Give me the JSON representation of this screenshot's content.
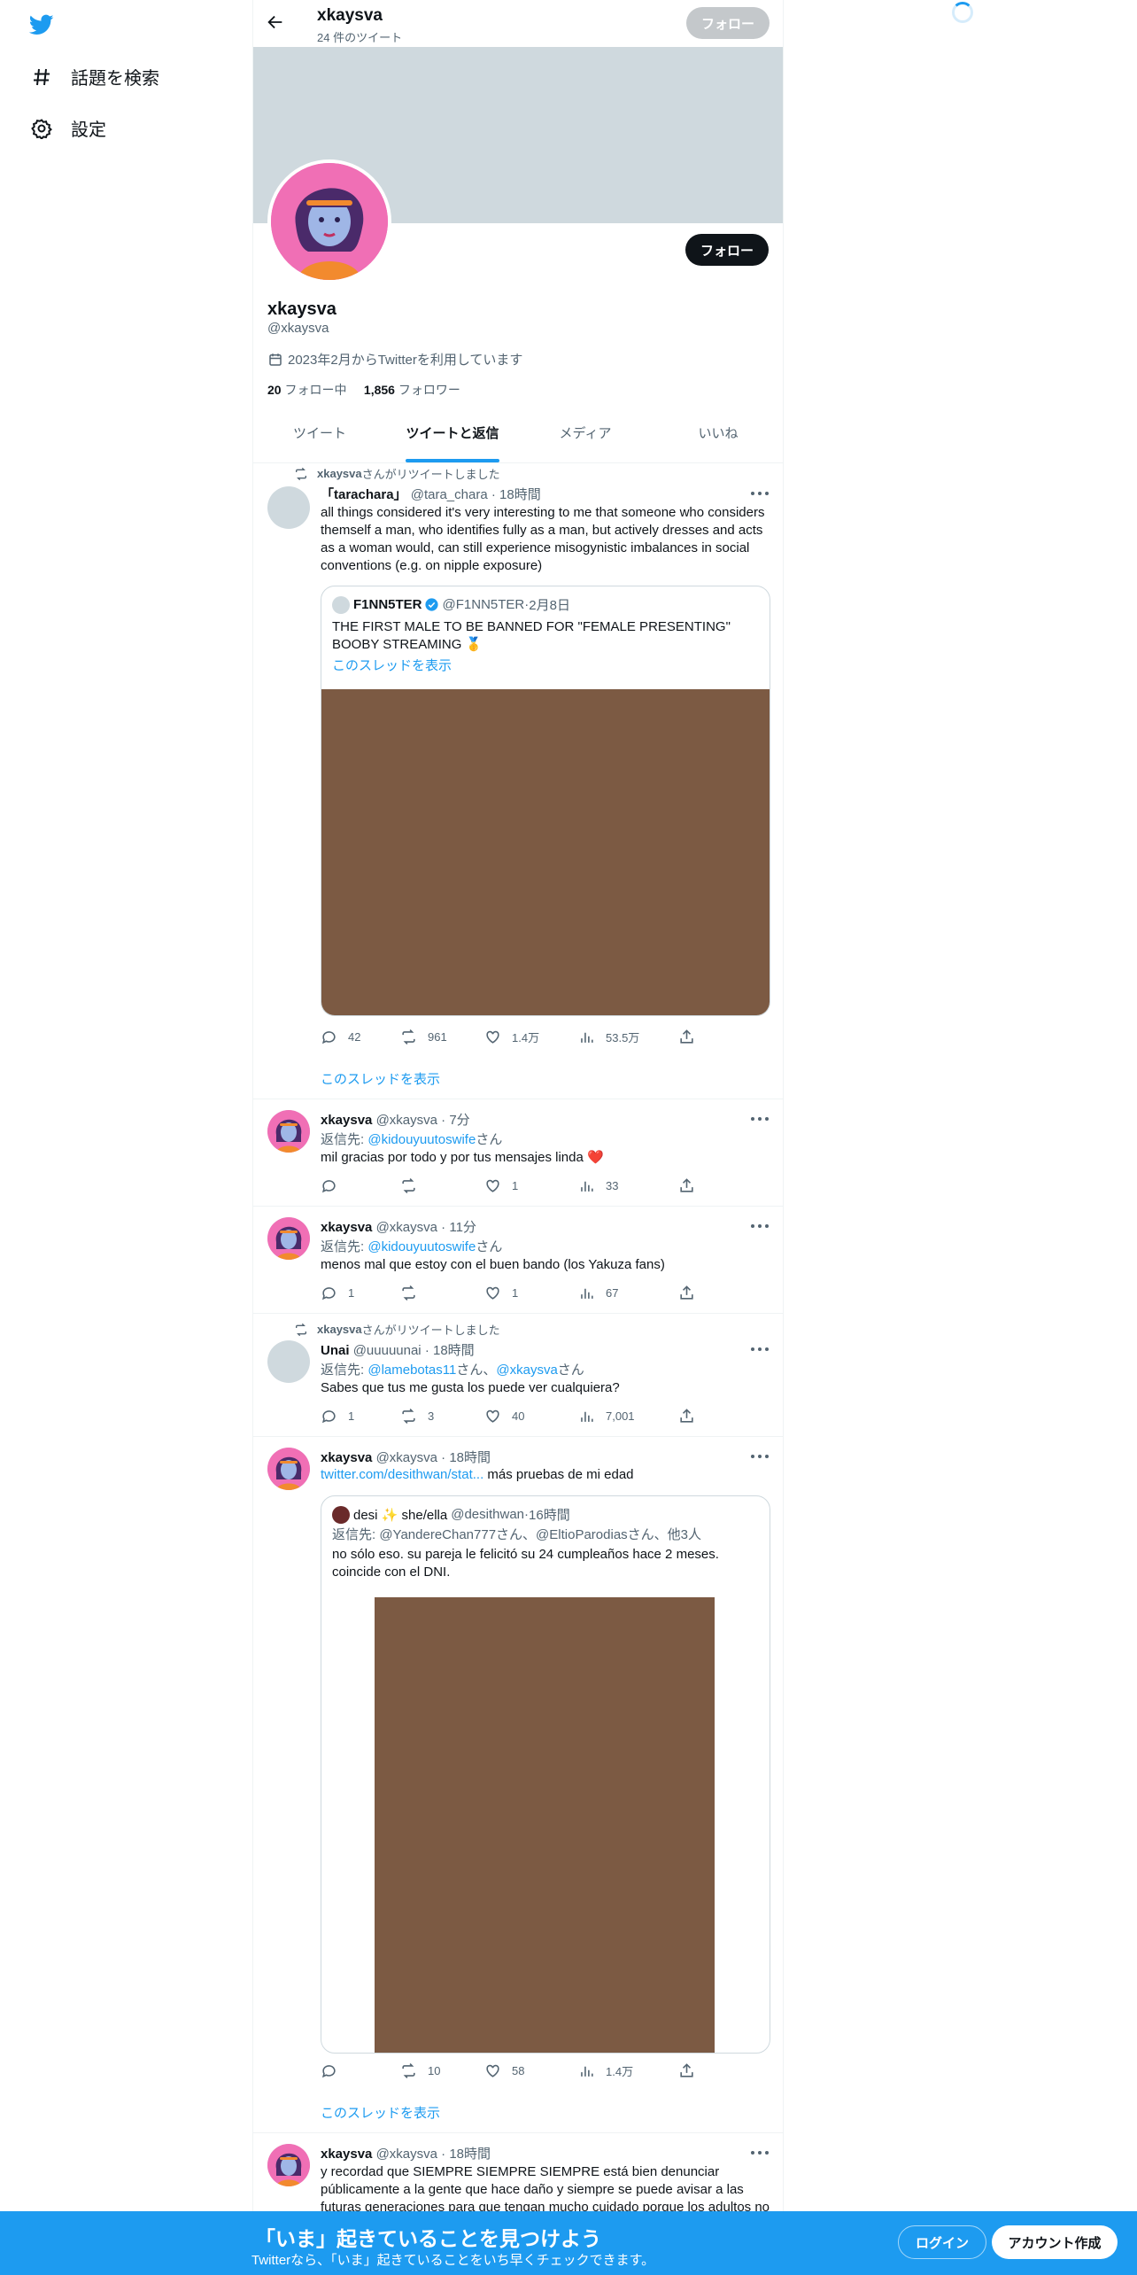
{
  "sidebar": {
    "logo_icon": "twitter-bird-icon",
    "items": [
      {
        "label": "話題を検索",
        "icon": "hashtag-icon"
      },
      {
        "label": "設定",
        "icon": "gear-icon"
      }
    ]
  },
  "header": {
    "name": "xkaysva",
    "tweet_count": "24 件のツイート",
    "follow_label": "フォロー"
  },
  "profile": {
    "name": "xkaysva",
    "handle": "@xkaysva",
    "joined": "2023年2月からTwitterを利用しています",
    "following_count": "20",
    "following_label": "フォロー中",
    "followers_count": "1,856",
    "followers_label": "フォロワー",
    "follow_label": "フォロー"
  },
  "tabs": [
    {
      "label": "ツイート"
    },
    {
      "label": "ツイートと返信",
      "active": true
    },
    {
      "label": "メディア"
    },
    {
      "label": "いいね"
    }
  ],
  "tweets": [
    {
      "retweeted_by": "xkaysva",
      "retweet_suffix": "さんがリツイートしました",
      "name": "「tarachara」",
      "handle": "@tara_chara",
      "time": "18時間",
      "text_lines": [
        "all things considered it's very interesting to me that someone who considers",
        "themself a man, who identifies fully as a man, but actively dresses and acts",
        "as a woman would, can still experience misogynistic imbalances in social",
        "conventions (e.g. on nipple exposure)"
      ],
      "quote": {
        "name": "F1NN5TER",
        "handle": "@F1NN5TER",
        "time": "2月8日",
        "text_lines": [
          "THE FIRST MALE TO BE BANNED FOR \"FEMALE PRESENTING\"",
          "BOOBY STREAMING 🥇"
        ],
        "show_thread": "このスレッドを表示"
      },
      "replies": "42",
      "retweets": "961",
      "likes": "1.4万",
      "views": "53.5万",
      "show_thread": "このスレッドを表示"
    },
    {
      "name": "xkaysva",
      "handle": "@xkaysva",
      "time": "7分",
      "reply_prefix": "返信先: ",
      "reply_to": "@kidouyuutoswife",
      "reply_suffix": "さん",
      "text": "mil gracias por todo y por tus mensajes linda ❤️",
      "replies": "",
      "retweets": "",
      "likes": "1",
      "views": "33"
    },
    {
      "name": "xkaysva",
      "handle": "@xkaysva",
      "time": "11分",
      "reply_prefix": "返信先: ",
      "reply_to": "@kidouyuutoswife",
      "reply_suffix": "さん",
      "text": "menos mal que estoy con el buen bando (los Yakuza fans)",
      "replies": "1",
      "retweets": "",
      "likes": "1",
      "views": "67"
    },
    {
      "retweeted_by": "xkaysva",
      "retweet_suffix": "さんがリツイートしました",
      "name": "Unai",
      "handle": "@uuuuunai",
      "time": "18時間",
      "reply_prefix": "返信先: ",
      "reply_to": "@lamebotas11",
      "reply_mid": "さん、",
      "reply_to2": "@xkaysva",
      "reply_suffix": "さん",
      "text": "Sabes que tus me gusta los puede ver cualquiera?",
      "replies": "1",
      "retweets": "3",
      "likes": "40",
      "views": "7,001"
    },
    {
      "name": "xkaysva",
      "handle": "@xkaysva",
      "time": "18時間",
      "link": "twitter.com/desithwan/stat...",
      "text": " más pruebas de mi edad",
      "quote": {
        "name": "desi ✨ she/ella",
        "handle": "@desithwan",
        "time": "16時間",
        "reply_line": "返信先: @YandereChan777さん、@EltioParodiasさん、他3人",
        "text_lines": [
          "no sólo eso. su pareja le felicitó su 24 cumpleaños hace 2 meses.",
          "coincide con el DNI."
        ]
      },
      "replies": "",
      "retweets": "10",
      "likes": "58",
      "views": "1.4万",
      "show_thread": "このスレッドを表示"
    },
    {
      "name": "xkaysva",
      "handle": "@xkaysva",
      "time": "18時間",
      "text_lines": [
        "y recordad que SIEMPRE SIEMPRE SIEMPRE está bien denunciar",
        "públicamente a la gente que hace daño y siempre se puede avisar a las",
        "futuras generaciones para que tengan mucho cuidado porque los adultos no"
      ]
    }
  ],
  "bottom_bar": {
    "title": "「いま」起きていることを見つけよう",
    "subtitle": "Twitterなら、「いま」起きていることをいち早くチェックできます。",
    "login": "ログイン",
    "signup": "アカウント作成"
  },
  "colors": {
    "accent": "#1d9bf0",
    "banner": "#cfd9de",
    "media": "#7c5a43",
    "avatar_bg": "#f06fb5"
  }
}
